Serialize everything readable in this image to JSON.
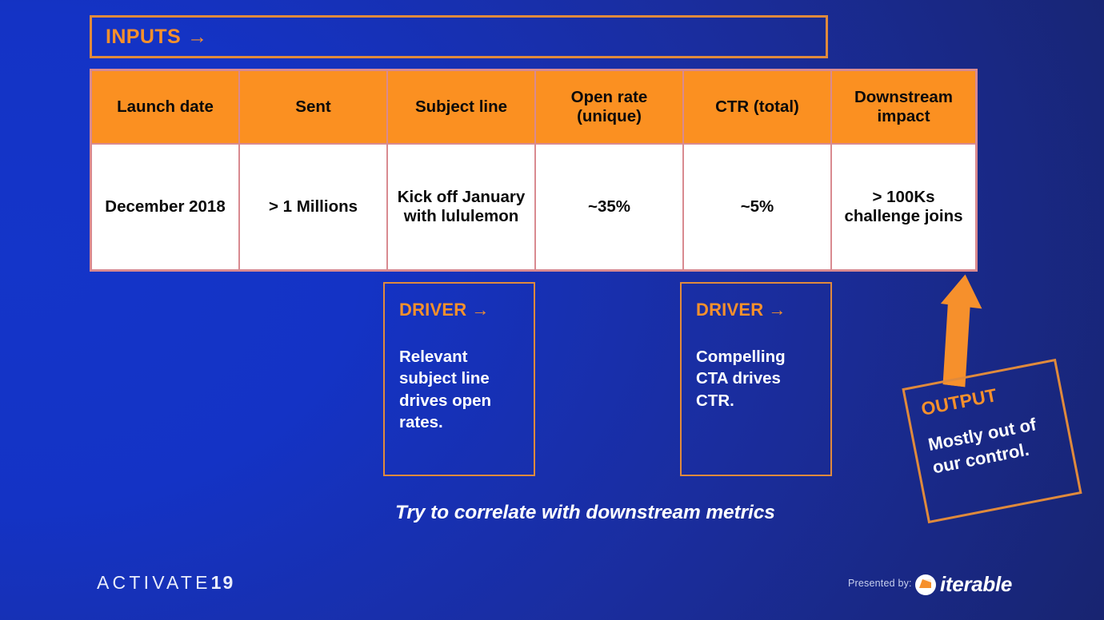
{
  "slide": {
    "background_left": "#1435c9",
    "background_right": "#18246f",
    "accent_orange": "#f6902c",
    "header_fill": "#fb9021",
    "table_border": "#d98a90"
  },
  "inputs_banner": {
    "label": "INPUTS",
    "arrow": "→"
  },
  "table": {
    "columns": [
      "Launch date",
      "Sent",
      "Subject line",
      "Open rate\n(unique)",
      "CTR (total)",
      "Downstream\nimpact"
    ],
    "columns_display": {
      "c1": "Launch date",
      "c2": "Sent",
      "c3": "Subject line",
      "c4": "Open rate (unique)",
      "c5": "CTR (total)",
      "c6": "Downstream impact"
    },
    "rows": [
      {
        "launch_date": "December 2018",
        "sent": "> 1 Millions",
        "subject_line": "Kick off January with lululemon",
        "open_rate": "~35%",
        "ctr": "~5%",
        "downstream_impact": "> 100Ks challenge joins"
      }
    ]
  },
  "drivers": [
    {
      "title": "DRIVER",
      "arrow": "→",
      "text": "Relevant subject line drives open rates."
    },
    {
      "title": "DRIVER",
      "arrow": "→",
      "text": "Compelling CTA drives CTR."
    }
  ],
  "caption": "Try to correlate with downstream metrics",
  "output_callout": {
    "title": "OUTPUT",
    "text": "Mostly out of our control."
  },
  "footer": {
    "activate_text": "ACTIVATE",
    "activate_year": "19",
    "presented_by": "Presented by:",
    "brand": "iterable"
  }
}
